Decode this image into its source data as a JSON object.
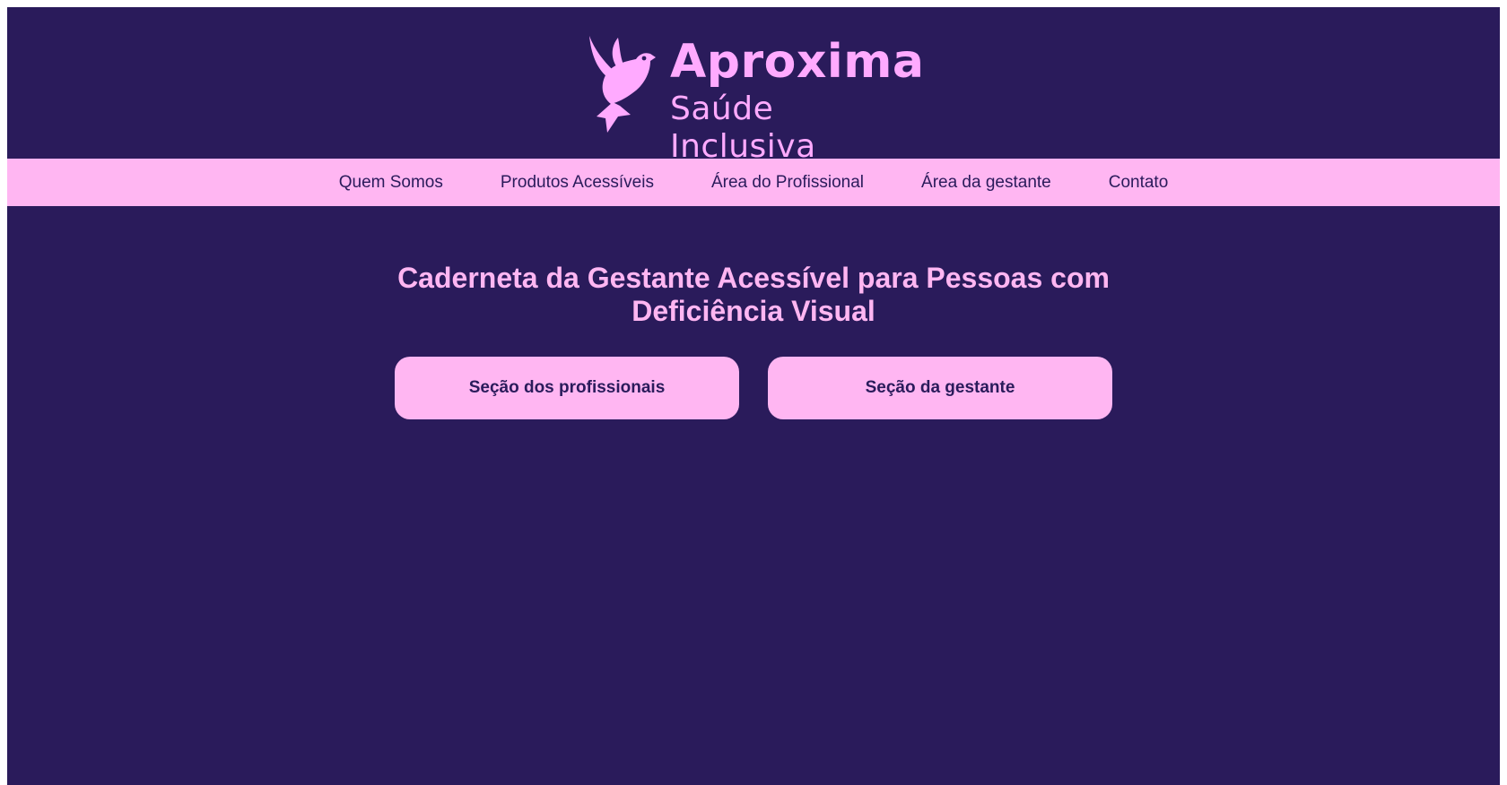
{
  "brand": {
    "name": "Aproxima",
    "tagline": "Saúde Inclusiva",
    "logo_icon": "dove-icon",
    "colors": {
      "background": "#2a1b5b",
      "accent": "#ffb6f2",
      "logo": "#ffaaff"
    }
  },
  "nav": {
    "items": [
      {
        "label": "Quem Somos"
      },
      {
        "label": "Produtos Acessíveis"
      },
      {
        "label": "Área do Profissional"
      },
      {
        "label": "Área da gestante"
      },
      {
        "label": "Contato"
      }
    ]
  },
  "main": {
    "title": "Caderneta da Gestante Acessível para Pessoas com Deficiência Visual",
    "buttons": {
      "professionals_label": "Seção dos profissionais",
      "pregnant_label": "Seção da gestante"
    }
  }
}
